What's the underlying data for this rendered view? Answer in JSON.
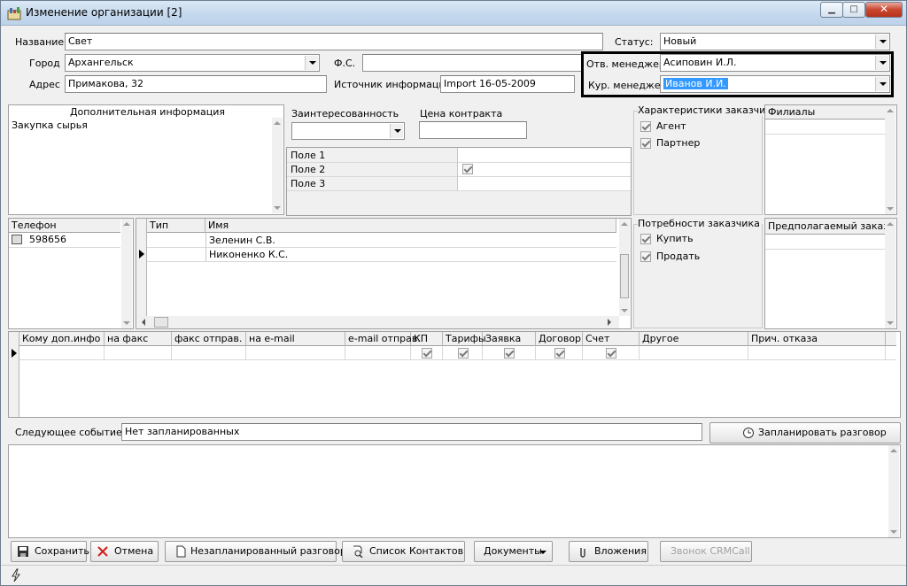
{
  "window": {
    "title": "Изменение организации [2]"
  },
  "fields": {
    "name_label": "Название",
    "name_value": "Свет",
    "status_label": "Статус:",
    "status_value": "Новый",
    "city_label": "Город",
    "city_value": "Архангельск",
    "fs_label": "Ф.С.",
    "fs_value": "",
    "resp_manager_label": "Отв. менеджер",
    "resp_manager_value": "Асиповин И.Л.",
    "address_label": "Адрес",
    "address_value": "Примакова, 32",
    "source_label": "Источник информации",
    "source_value": "Import 16-05-2009",
    "cur_manager_label": "Кур. менеджер",
    "cur_manager_value": "Иванов И.И."
  },
  "additional_info": {
    "title": "Дополнительная информация",
    "text": "Закупка сырья"
  },
  "interest": {
    "label": "Заинтересованность",
    "value": "",
    "price_label": "Цена контракта",
    "price_value": ""
  },
  "custom_fields": [
    {
      "name": "Поле 1",
      "checked": false
    },
    {
      "name": "Поле 2",
      "checked": true
    },
    {
      "name": "Поле 3",
      "checked": false
    }
  ],
  "characteristics": {
    "title": "Характеристики заказчика",
    "items": [
      {
        "label": "Агент",
        "checked": true
      },
      {
        "label": "Партнер",
        "checked": true
      }
    ]
  },
  "branches": {
    "title": "Филиалы"
  },
  "phones": {
    "title": "Телефон",
    "items": [
      "598656"
    ]
  },
  "contacts": {
    "col_type": "Тип",
    "col_name": "Имя",
    "rows": [
      "Зеленин С.В.",
      "Никоненко К.С."
    ]
  },
  "needs": {
    "title": "Потребности заказчика",
    "items": [
      {
        "label": "Купить",
        "checked": true
      },
      {
        "label": "Продать",
        "checked": true
      }
    ]
  },
  "expected_order": {
    "title": "Предполагаемый заказ"
  },
  "dispatch": {
    "columns": [
      "Кому доп.инфо",
      "на факс",
      "факс отправ.",
      "на e-mail",
      "e-mail отправ.",
      "КП",
      "Тарифы",
      "Заявка",
      "Договор",
      "Счет",
      "Другое",
      "Прич. отказа"
    ]
  },
  "next_event": {
    "label": "Следующее событие :",
    "value": "Нет запланированных",
    "schedule_button": "Запланировать разговор"
  },
  "toolbar": {
    "save": "Сохранить",
    "cancel": "Отмена",
    "unplanned": "Незапланированный разговор",
    "contacts_list": "Список Контактов",
    "documents": "Документы",
    "attachments": "Вложения",
    "crm_call": "Звонок CRMCall"
  },
  "colors": {
    "highlight_border": "#000000",
    "selection_bg": "#3399ff",
    "window_bg": "#f0f0f0"
  }
}
